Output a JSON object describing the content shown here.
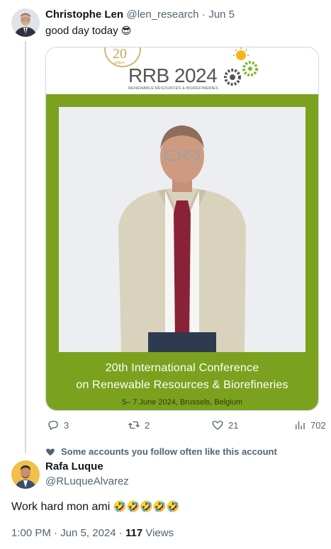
{
  "tweet1": {
    "author_name": "Christophe Len",
    "handle": "@len_research",
    "separator": "·",
    "date": "Jun 5",
    "text": "good day today",
    "emoji": "😎",
    "image": {
      "logo_number": "20",
      "logo_small": "edition",
      "title": "RRB 2024",
      "subtitle": "RENEWABLE RESOURCES & BIOREFINERIES",
      "line1": "20th International Conference",
      "line2": "on Renewable Resources & Biorefineries",
      "date_line": "5– 7 June 2024, Brussels, Belgium"
    },
    "actions": {
      "replies": "3",
      "reposts": "2",
      "likes": "21",
      "views": "702"
    }
  },
  "social_context": "Some accounts you follow often like this account",
  "tweet2": {
    "author_name": "Rafa Luque",
    "handle": "@RLuqueAlvarez",
    "text": "Work hard mon ami",
    "emoji": "🤣🤣🤣🤣🤣",
    "time": "1:00 PM",
    "separator": "·",
    "date": "Jun 5, 2024",
    "dot": "·",
    "views_count": "117",
    "views_label": "Views"
  },
  "colors": {
    "muted": "#536471",
    "green_background": "#7aa21f",
    "line": "#cfd9de"
  }
}
